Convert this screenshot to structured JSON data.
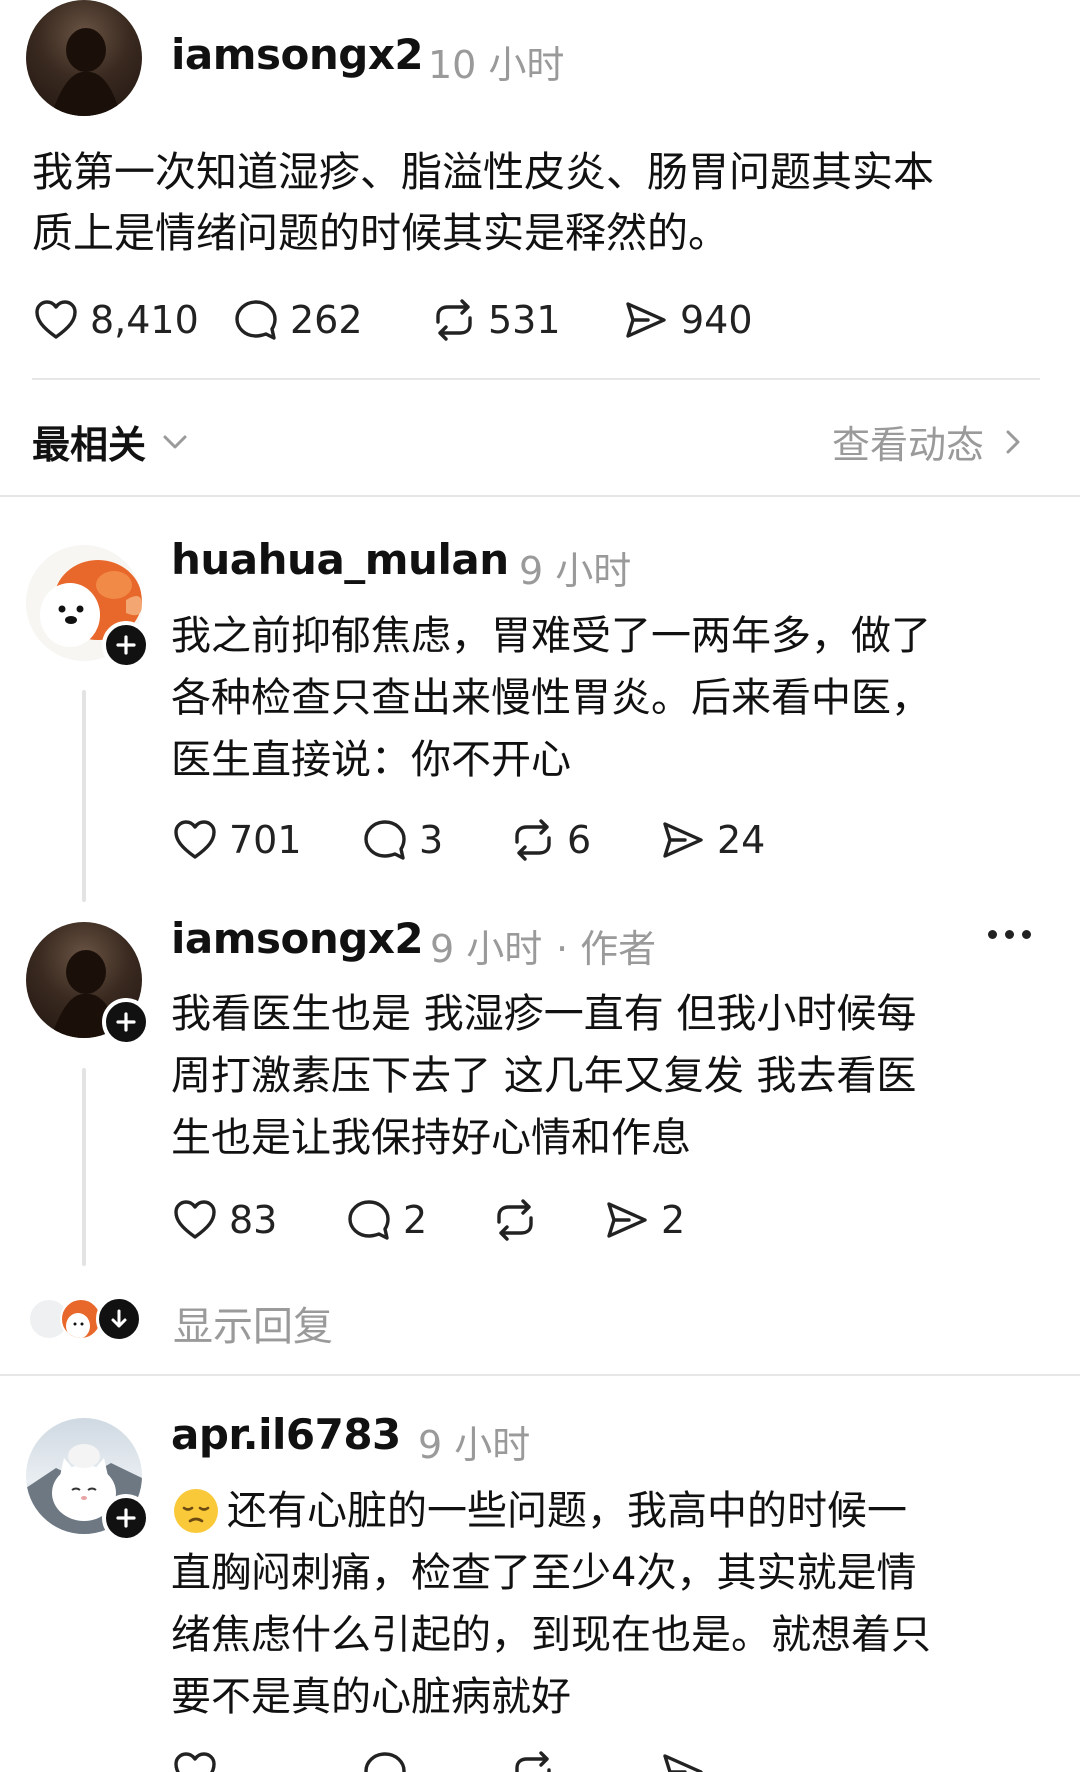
{
  "post": {
    "username": "iamsongx2",
    "time": "10 小时",
    "text_line1": "我第一次知道湿疹、脂溢性皮炎、肠胃问题其实本",
    "text_line2": "质上是情绪问题的时候其实是释然的。",
    "likes": "8,410",
    "comments": "262",
    "reposts": "531",
    "shares": "940"
  },
  "sort_bar": {
    "label": "最相关",
    "activity_link": "查看动态"
  },
  "replies": [
    {
      "username": "huahua_mulan",
      "time": "9 小时",
      "lines": [
        "我之前抑郁焦虑，胃难受了一两年多，做了",
        "各种检查只查出来慢性胃炎。后来看中医，",
        "医生直接说：你不开心"
      ],
      "likes": "701",
      "comments": "3",
      "reposts": "6",
      "shares": "24"
    },
    {
      "username": "iamsongx2",
      "time": "9 小时",
      "author_tag": "· 作者",
      "lines": [
        "我看医生也是 我湿疹一直有 但我小时候每",
        "周打激素压下去了 这几年又复发 我去看医",
        "生也是让我保持好心情和作息"
      ],
      "likes": "83",
      "comments": "2",
      "shares": "2"
    },
    {
      "username": "apr.il6783",
      "time": "9 小时",
      "emoji": "😔",
      "lines": [
        "还有心脏的一些问题，我高中的时候一",
        "直胸闷刺痛，检查了至少4次，其实就是情",
        "绪焦虑什么引起的，到现在也是。就想着只",
        "要不是真的心脏病就好"
      ]
    }
  ],
  "show_replies": "显示回复",
  "colors": {
    "text": "#111111",
    "muted": "#9a9a9a",
    "divider": "#e6e6e6"
  }
}
